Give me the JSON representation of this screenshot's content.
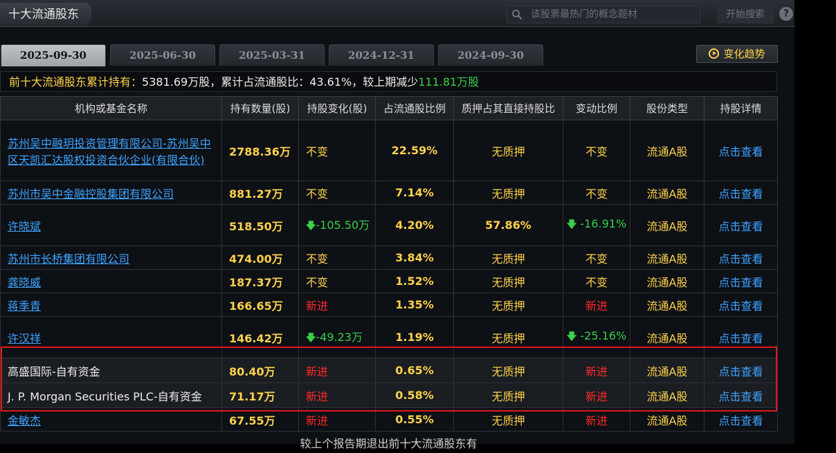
{
  "header": {
    "title": "十大流通股东",
    "search_placeholder": "该股票最热门的概念题材",
    "search_button": "开始搜索",
    "help_label": "?"
  },
  "tabs": [
    {
      "label": "2025-09-30",
      "active": true
    },
    {
      "label": "2025-06-30",
      "active": false
    },
    {
      "label": "2025-03-31",
      "active": false
    },
    {
      "label": "2024-12-31",
      "active": false
    },
    {
      "label": "2024-09-30",
      "active": false
    }
  ],
  "trend_button": "变化趋势",
  "summary": {
    "p1": "前十大流通股东累计持有：",
    "v1": "5381.69",
    "p2": "万股，累计占流通股比：",
    "v2": "43.61%",
    "p3": "，较上期减少",
    "v3": "111.81万股"
  },
  "columns": [
    "机构或基金名称",
    "持有数量(股)",
    "持股变化(股)",
    "占流通股比例",
    "质押占其直接持股比",
    "变动比例",
    "股份类型",
    "持股详情"
  ],
  "rows": [
    {
      "name": "苏州吴中融玥投资管理有限公司-苏州吴中区天凯汇达股权投资合伙企业(有限合伙)",
      "link": true,
      "holding": "2788.36万",
      "change": "不变",
      "change_color": "yellow",
      "ratio": "22.59%",
      "pledge": "无质押",
      "chg_ratio": "不变",
      "chg_ratio_color": "yellow",
      "type": "流通A股",
      "detail": "点击查看"
    },
    {
      "name": "苏州市吴中金融控股集团有限公司",
      "link": true,
      "holding": "881.27万",
      "change": "不变",
      "change_color": "yellow",
      "ratio": "7.14%",
      "pledge": "无质押",
      "chg_ratio": "不变",
      "chg_ratio_color": "yellow",
      "type": "流通A股",
      "detail": "点击查看"
    },
    {
      "name": "许晓斌",
      "link": true,
      "holding": "518.50万",
      "change": "-105.50万",
      "change_color": "green",
      "ratio": "4.20%",
      "pledge": "57.86%",
      "chg_ratio": "-16.91%",
      "chg_ratio_color": "green",
      "type": "流通A股",
      "detail": "点击查看"
    },
    {
      "name": "苏州市长桥集团有限公司",
      "link": true,
      "holding": "474.00万",
      "change": "不变",
      "change_color": "yellow",
      "ratio": "3.84%",
      "pledge": "无质押",
      "chg_ratio": "不变",
      "chg_ratio_color": "yellow",
      "type": "流通A股",
      "detail": "点击查看"
    },
    {
      "name": "龚晓威",
      "link": true,
      "holding": "187.37万",
      "change": "不变",
      "change_color": "yellow",
      "ratio": "1.52%",
      "pledge": "无质押",
      "chg_ratio": "不变",
      "chg_ratio_color": "yellow",
      "type": "流通A股",
      "detail": "点击查看"
    },
    {
      "name": "蒋季青",
      "link": true,
      "holding": "166.65万",
      "change": "新进",
      "change_color": "red",
      "ratio": "1.35%",
      "pledge": "无质押",
      "chg_ratio": "新进",
      "chg_ratio_color": "red",
      "type": "流通A股",
      "detail": "点击查看"
    },
    {
      "name": "许汉祥",
      "link": true,
      "holding": "146.42万",
      "change": "-49.23万",
      "change_color": "green",
      "ratio": "1.19%",
      "pledge": "无质押",
      "chg_ratio": "-25.16%",
      "chg_ratio_color": "green",
      "type": "流通A股",
      "detail": "点击查看"
    },
    {
      "name": "高盛国际-自有资金",
      "link": false,
      "holding": "80.40万",
      "change": "新进",
      "change_color": "red",
      "ratio": "0.65%",
      "pledge": "无质押",
      "chg_ratio": "新进",
      "chg_ratio_color": "red",
      "type": "流通A股",
      "detail": "点击查看"
    },
    {
      "name": "J. P. Morgan Securities PLC-自有资金",
      "link": false,
      "holding": "71.17万",
      "change": "新进",
      "change_color": "red",
      "ratio": "0.58%",
      "pledge": "无质押",
      "chg_ratio": "新进",
      "chg_ratio_color": "red",
      "type": "流通A股",
      "detail": "点击查看"
    },
    {
      "name": "金敏杰",
      "link": true,
      "holding": "67.55万",
      "change": "新进",
      "change_color": "red",
      "ratio": "0.55%",
      "pledge": "无质押",
      "chg_ratio": "新进",
      "chg_ratio_color": "red",
      "type": "流通A股",
      "detail": "点击查看"
    }
  ],
  "footer": "较上个报告期退出前十大流通股东有",
  "colors": {
    "accent": "#ffd24a",
    "link": "#3fa3ff",
    "up": "#ff2a2a",
    "down": "#39d04a",
    "highlight": "#e11919"
  }
}
